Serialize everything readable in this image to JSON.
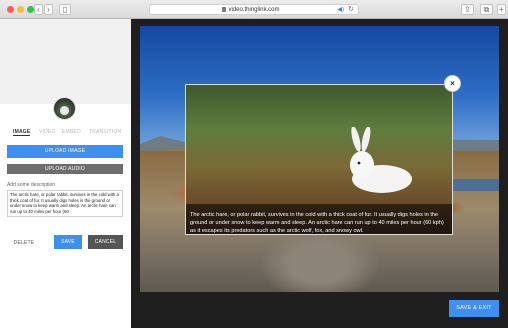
{
  "browser": {
    "url": "video.thinglink.com",
    "colors": {
      "close": "#ff5f57",
      "minimize": "#febc2e",
      "zoom": "#28c840"
    }
  },
  "sidebar": {
    "tabs": [
      {
        "label": "IMAGE",
        "active": true
      },
      {
        "label": "VIDEO",
        "active": false
      },
      {
        "label": "EMBED",
        "active": false
      },
      {
        "label": "TRANSITION",
        "active": false
      }
    ],
    "upload_image_label": "UPLOAD IMAGE",
    "upload_audio_label": "UPLOAD AUDIO",
    "description_label": "Add some description",
    "description_text": "The arctic hare, or polar rabbit, survives in the cold with a thick coat of fur. It usually digs holes in the ground or under snow to keep warm and sleep. An arctic hare can run up to 40 miles per hour (60",
    "delete_label": "DELETE",
    "save_label": "SAVE",
    "cancel_label": "CANCEL"
  },
  "modal": {
    "caption": "The arctic hare, or polar rabbit, survives in the cold with a thick coat of fur. It usually digs holes in the ground or under snow to keep warm and sleep. An arctic hare can run up to 40 miles per hour (60 kph) as it escapes its predators such as the arctic wolf, fox, and snowy owl.",
    "close_label": "×"
  },
  "save_exit_label": "SAVE & EXIT",
  "accent_color": "#3f8ff0"
}
